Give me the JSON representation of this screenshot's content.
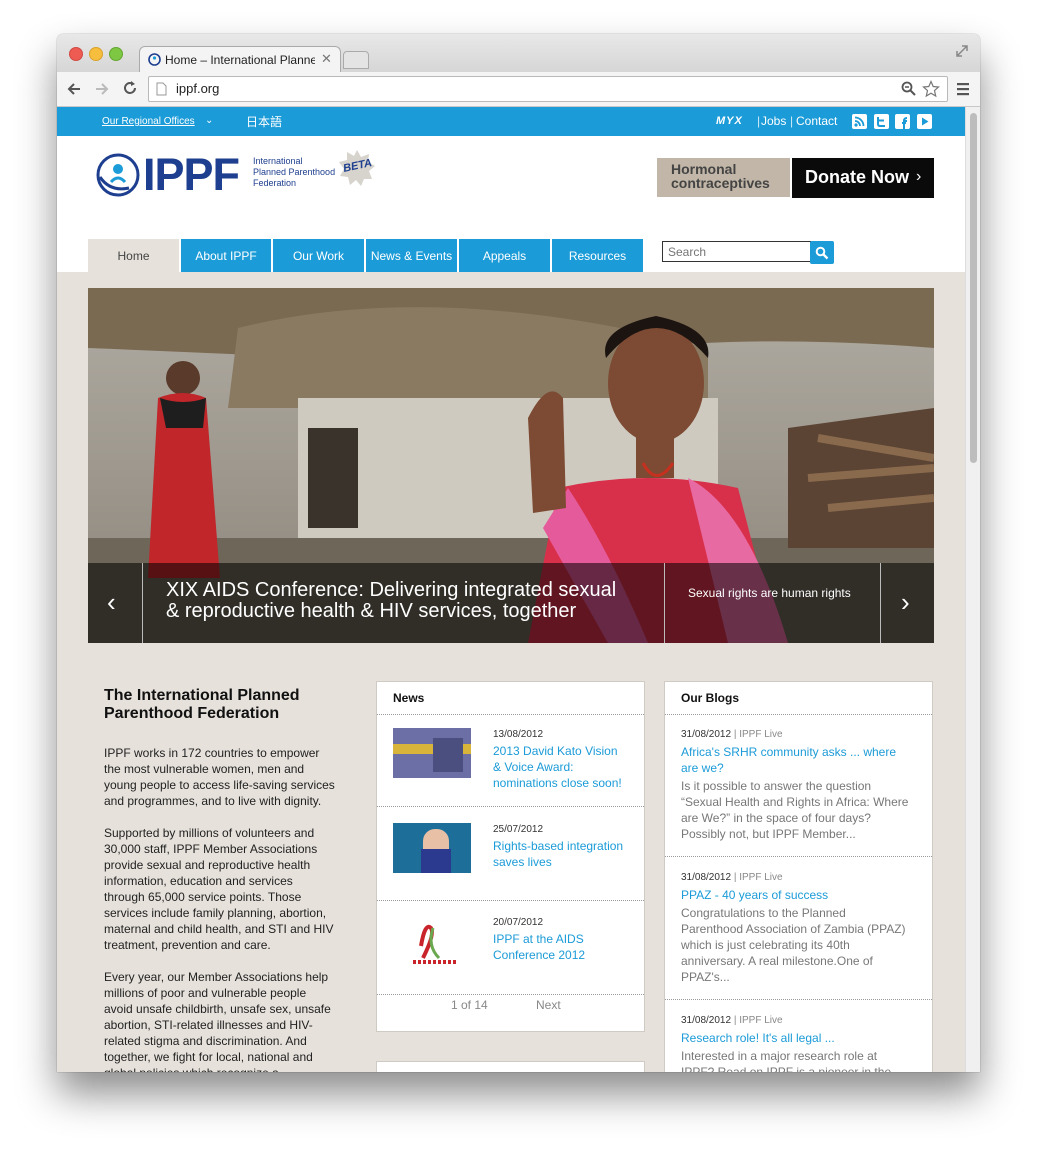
{
  "browser": {
    "tab_title": "Home – International Planne",
    "url": "ippf.org"
  },
  "topbar": {
    "regional_offices": "Our Regional Offices",
    "japanese": "日本語",
    "myx": "MYX",
    "jobs": "Jobs",
    "contact": "Contact"
  },
  "header": {
    "logo_text": "IPPF",
    "logo_subtitle_1": "International",
    "logo_subtitle_2": "Planned Parenthood",
    "logo_subtitle_3": "Federation",
    "beta": "BETA",
    "hormonal_1": "Hormonal",
    "hormonal_2": "contraceptives",
    "donate": "Donate Now"
  },
  "nav": [
    "Home",
    "About IPPF",
    "Our Work",
    "News & Events",
    "Appeals",
    "Resources"
  ],
  "search": {
    "placeholder": "Search"
  },
  "slider": {
    "caption_1": "XIX AIDS Conference: Delivering integrated sexual",
    "caption_2": "& reproductive health & HIV services, together",
    "next_title": "Sexual rights are human rights"
  },
  "intro": {
    "title_1": "The International Planned",
    "title_2": "Parenthood Federation",
    "p1": [
      "IPPF works in 172 countries to empower",
      "the most vulnerable women, men and",
      "young people to access life-saving services",
      "and programmes, and to live with dignity."
    ],
    "p2": [
      "Supported by millions of volunteers and",
      "30,000 staff, IPPF Member Associations",
      "provide sexual and reproductive health",
      "information, education and services",
      "through 65,000 service points. Those",
      "services include family planning, abortion,",
      "maternal and child health, and STI and HIV",
      "treatment, prevention and care."
    ],
    "p3": [
      "Every year, our Member Associations help",
      "millions of poor and vulnerable people",
      "avoid unsafe childbirth, unsafe sex, unsafe",
      "abortion, STI-related illnesses and HIV-",
      "related stigma and discrimination. And",
      "together, we fight for local, national and",
      "global policies which recognize a"
    ]
  },
  "news": {
    "heading": "News",
    "items": [
      {
        "date": "13/08/2012",
        "lines": [
          "2013 David Kato Vision",
          "& Voice Award:",
          "nominations close soon!"
        ]
      },
      {
        "date": "25/07/2012",
        "lines": [
          "Rights-based integration",
          "saves lives"
        ]
      },
      {
        "date": "20/07/2012",
        "lines": [
          "IPPF at the AIDS",
          "Conference 2012"
        ]
      }
    ],
    "pager": "1 of 14",
    "next": "Next"
  },
  "blogs": {
    "heading": "Our Blogs",
    "items": [
      {
        "date": "31/08/2012",
        "source": "| IPPF Live",
        "title": [
          "Africa's SRHR community asks ... where",
          "are we?"
        ],
        "excerpt": [
          "Is it possible to answer the question",
          "“Sexual Health and Rights in Africa: Where",
          "are We?” in the space of four days?",
          "Possibly not, but IPPF Member..."
        ]
      },
      {
        "date": "31/08/2012",
        "source": "| IPPF Live",
        "title": [
          "PPAZ - 40 years of success"
        ],
        "excerpt": [
          "Congratulations to the Planned",
          "Parenthood Association of Zambia (PPAZ)",
          "which is just celebrating its 40th",
          "anniversary. A real milestone.One of",
          "PPAZ's..."
        ]
      },
      {
        "date": "31/08/2012",
        "source": "| IPPF Live",
        "title": [
          "Research role! It's all legal ..."
        ],
        "excerpt": [
          "Interested in a major research role at",
          "IPPF? Read on.IPPF is a pioneer in the"
        ]
      }
    ]
  },
  "colors": {
    "brand_blue": "#1b9bd7",
    "logo_navy": "#1e3f8f",
    "page_bg": "#e6e1db"
  }
}
